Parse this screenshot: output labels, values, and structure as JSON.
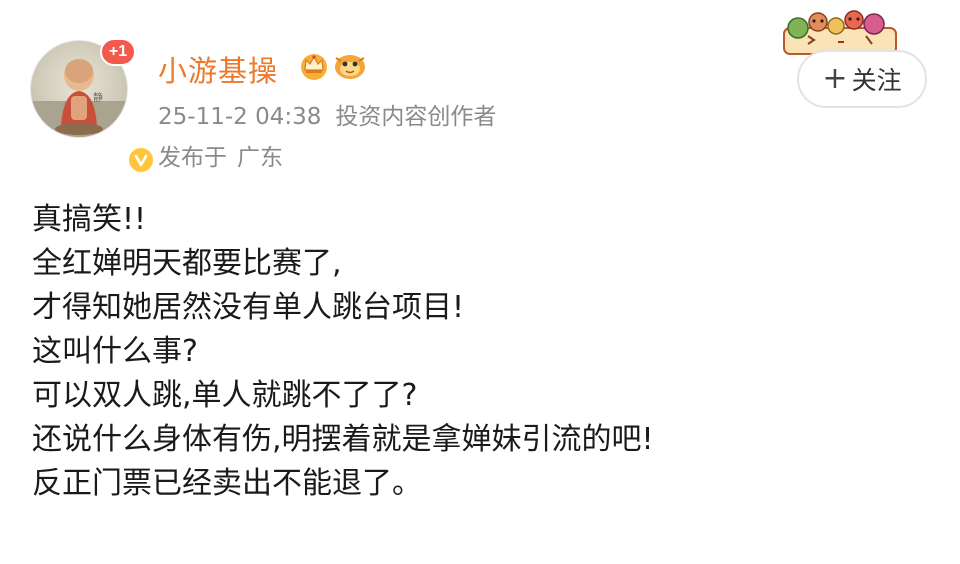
{
  "author": {
    "name": "小游基操",
    "notification_count": "+1",
    "avatar_icon": "monk-figurine-avatar",
    "verified_icon": "verified-v-icon",
    "badge_icons": [
      "crown-icon",
      "mascot-icon"
    ]
  },
  "meta": {
    "timestamp": "25-11-2 04:38",
    "role": "投资内容创作者",
    "location_prefix": "发布于",
    "location": "广东"
  },
  "follow": {
    "plus": "+",
    "label": "关注"
  },
  "post": {
    "lines": [
      "真搞笑!!",
      "全红婵明天都要比赛了,",
      "才得知她居然没有单人跳台项目!",
      "这叫什么事?",
      "可以双人跳,单人就跳不了了?",
      "还说什么身体有伤,明摆着就是拿婵妹引流的吧!",
      "反正门票已经卖出不能退了。"
    ]
  },
  "colors": {
    "name": "#ed7a2a",
    "meta": "#8a8a8a",
    "badge_red": "#f35a4d",
    "verified_yellow": "#ffc53d",
    "text": "#1a1a1a"
  }
}
